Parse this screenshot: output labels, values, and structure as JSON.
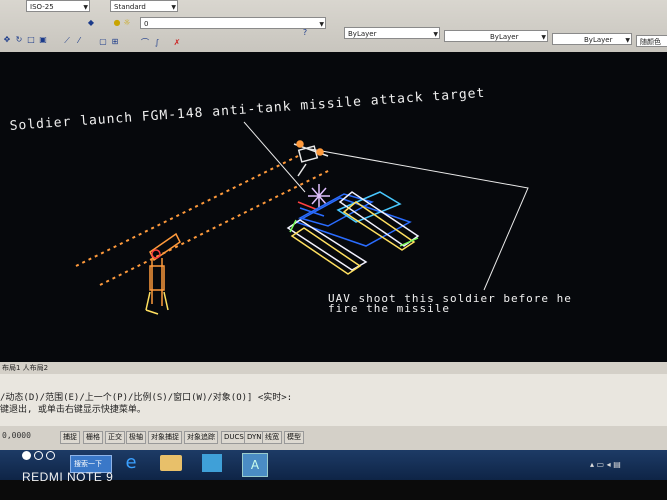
{
  "toolbar": {
    "dimstyle_combo": "ISO-25",
    "textstyle_combo": "Standard",
    "layer_combo": "0",
    "color_combo": "ByLayer",
    "linetype_combo": "ByLayer",
    "lineweight_combo": "ByLayer",
    "plotstyle_combo": "随颜色"
  },
  "drawing": {
    "title_annotation": "Soldier launch FGM-148 anti-tank missile attack target",
    "uav_annotation_line1": "UAV shoot this soldier before he",
    "uav_annotation_line2": "fire the missile"
  },
  "layout_tabs": "布局1 人布局2",
  "command_line": {
    "line1": "/动态(D)/范围(E)/上一个(P)/比例(S)/窗口(W)/对象(O)] <实时>:",
    "line2": "键退出, 或单击右键显示快捷菜单。"
  },
  "status_bar": {
    "coords": "0,0000",
    "buttons": [
      "捕捉",
      "栅格",
      "正交",
      "极轴",
      "对象捕捉",
      "对象追踪",
      "DUCS",
      "DYN",
      "线宽",
      "模型"
    ]
  },
  "taskbar": {
    "search_label": "搜索一下"
  },
  "watermark": "REDMI NOTE 9"
}
